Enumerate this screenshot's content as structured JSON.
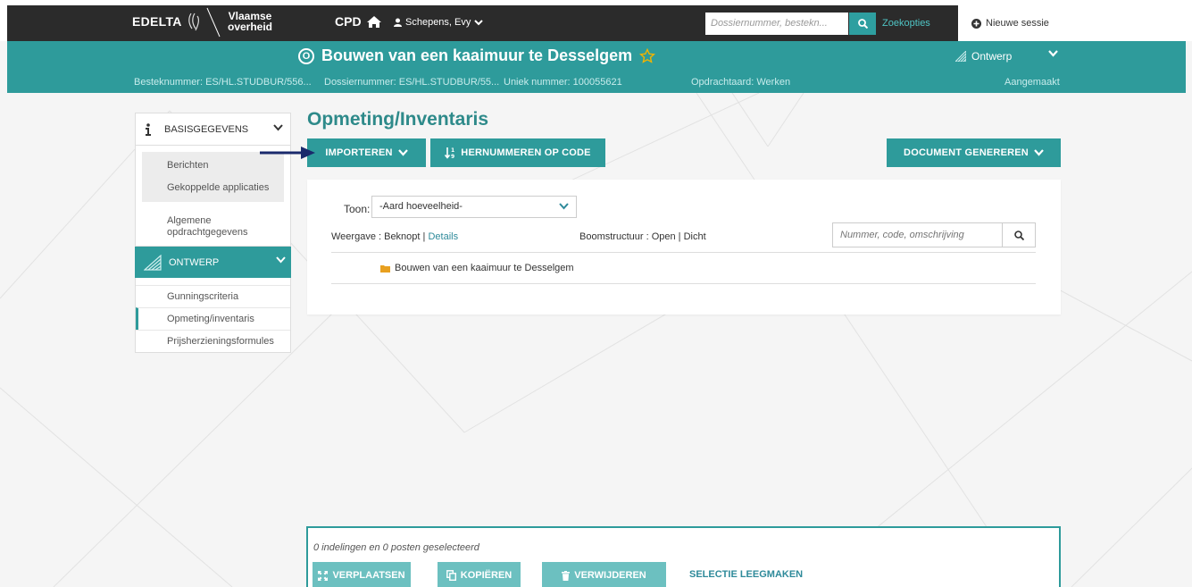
{
  "topbar": {
    "brand": "EDELTA",
    "gov_line1": "Vlaamse",
    "gov_line2": "overheid",
    "app": "CPD",
    "user": "Schepens, Evy",
    "search_placeholder": "Dossiernummer, bestekn...",
    "zoekopties": "Zoekopties",
    "nieuwe_sessie": "Nieuwe sessie"
  },
  "titlebar": {
    "title": "Bouwen van een kaaimuur te Desselgem",
    "circle_letter": "O",
    "phase": "Ontwerp",
    "besteknummer": "Besteknummer: ES/HL.STUDBUR/556...",
    "dossiernummer": "Dossiernummer: ES/HL.STUDBUR/55...",
    "uniek": "Uniek nummer: 100055621",
    "opdrachtaard": "Opdrachtaard: Werken",
    "status": "Aangemaakt"
  },
  "sidebar": {
    "basisgegevens": "BASISGEGEVENS",
    "sub_items": [
      "Berichten",
      "Gekoppelde applicaties"
    ],
    "algemene_line1": "Algemene",
    "algemene_line2": "opdrachtgegevens",
    "ontwerp": "ONTWERP",
    "ontwerp_items": [
      "Gunningscriteria",
      "Opmeting/inventaris",
      "Prijsherzieningsformules"
    ]
  },
  "main": {
    "title": "Opmeting/Inventaris",
    "importeren": "IMPORTEREN",
    "hernummeren": "HERNUMMEREN OP CODE",
    "document": "DOCUMENT GENEREREN",
    "toon_label": "Toon:",
    "toon_value": "-Aard hoeveelheid-",
    "weergave_label": "Weergave : Beknopt",
    "weergave_sep": "|",
    "details": "Details",
    "boom_label": "Boomstructuur : Open",
    "boom_sep": "|",
    "dicht": "Dicht",
    "search_placeholder": "Nummer, code, omschrijving",
    "tree_item": "Bouwen van een kaaimuur te Desselgem"
  },
  "selection": {
    "text": "0 indelingen en 0 posten geselecteerd",
    "verplaatsen": "VERPLAATSEN",
    "kopieren": "KOPIËREN",
    "verwijderen": "VERWIJDEREN",
    "leegmaken": "SELECTIE LEEGMAKEN"
  },
  "colors": {
    "teal": "#2e9b9b",
    "dark": "#2b2b2b",
    "star": "#f0b400",
    "folder": "#e8a020",
    "arrow": "#1a2a6c"
  }
}
